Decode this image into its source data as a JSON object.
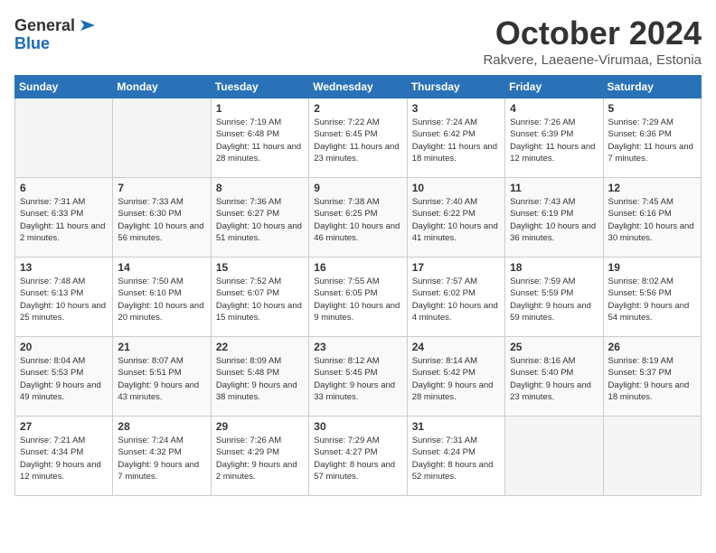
{
  "logo": {
    "general": "General",
    "blue": "Blue"
  },
  "title": "October 2024",
  "location": "Rakvere, Laeaene-Virumaa, Estonia",
  "headers": [
    "Sunday",
    "Monday",
    "Tuesday",
    "Wednesday",
    "Thursday",
    "Friday",
    "Saturday"
  ],
  "weeks": [
    [
      {
        "day": "",
        "content": ""
      },
      {
        "day": "",
        "content": ""
      },
      {
        "day": "1",
        "content": "Sunrise: 7:19 AM\nSunset: 6:48 PM\nDaylight: 11 hours and 28 minutes."
      },
      {
        "day": "2",
        "content": "Sunrise: 7:22 AM\nSunset: 6:45 PM\nDaylight: 11 hours and 23 minutes."
      },
      {
        "day": "3",
        "content": "Sunrise: 7:24 AM\nSunset: 6:42 PM\nDaylight: 11 hours and 18 minutes."
      },
      {
        "day": "4",
        "content": "Sunrise: 7:26 AM\nSunset: 6:39 PM\nDaylight: 11 hours and 12 minutes."
      },
      {
        "day": "5",
        "content": "Sunrise: 7:29 AM\nSunset: 6:36 PM\nDaylight: 11 hours and 7 minutes."
      }
    ],
    [
      {
        "day": "6",
        "content": "Sunrise: 7:31 AM\nSunset: 6:33 PM\nDaylight: 11 hours and 2 minutes."
      },
      {
        "day": "7",
        "content": "Sunrise: 7:33 AM\nSunset: 6:30 PM\nDaylight: 10 hours and 56 minutes."
      },
      {
        "day": "8",
        "content": "Sunrise: 7:36 AM\nSunset: 6:27 PM\nDaylight: 10 hours and 51 minutes."
      },
      {
        "day": "9",
        "content": "Sunrise: 7:38 AM\nSunset: 6:25 PM\nDaylight: 10 hours and 46 minutes."
      },
      {
        "day": "10",
        "content": "Sunrise: 7:40 AM\nSunset: 6:22 PM\nDaylight: 10 hours and 41 minutes."
      },
      {
        "day": "11",
        "content": "Sunrise: 7:43 AM\nSunset: 6:19 PM\nDaylight: 10 hours and 36 minutes."
      },
      {
        "day": "12",
        "content": "Sunrise: 7:45 AM\nSunset: 6:16 PM\nDaylight: 10 hours and 30 minutes."
      }
    ],
    [
      {
        "day": "13",
        "content": "Sunrise: 7:48 AM\nSunset: 6:13 PM\nDaylight: 10 hours and 25 minutes."
      },
      {
        "day": "14",
        "content": "Sunrise: 7:50 AM\nSunset: 6:10 PM\nDaylight: 10 hours and 20 minutes."
      },
      {
        "day": "15",
        "content": "Sunrise: 7:52 AM\nSunset: 6:07 PM\nDaylight: 10 hours and 15 minutes."
      },
      {
        "day": "16",
        "content": "Sunrise: 7:55 AM\nSunset: 6:05 PM\nDaylight: 10 hours and 9 minutes."
      },
      {
        "day": "17",
        "content": "Sunrise: 7:57 AM\nSunset: 6:02 PM\nDaylight: 10 hours and 4 minutes."
      },
      {
        "day": "18",
        "content": "Sunrise: 7:59 AM\nSunset: 5:59 PM\nDaylight: 9 hours and 59 minutes."
      },
      {
        "day": "19",
        "content": "Sunrise: 8:02 AM\nSunset: 5:56 PM\nDaylight: 9 hours and 54 minutes."
      }
    ],
    [
      {
        "day": "20",
        "content": "Sunrise: 8:04 AM\nSunset: 5:53 PM\nDaylight: 9 hours and 49 minutes."
      },
      {
        "day": "21",
        "content": "Sunrise: 8:07 AM\nSunset: 5:51 PM\nDaylight: 9 hours and 43 minutes."
      },
      {
        "day": "22",
        "content": "Sunrise: 8:09 AM\nSunset: 5:48 PM\nDaylight: 9 hours and 38 minutes."
      },
      {
        "day": "23",
        "content": "Sunrise: 8:12 AM\nSunset: 5:45 PM\nDaylight: 9 hours and 33 minutes."
      },
      {
        "day": "24",
        "content": "Sunrise: 8:14 AM\nSunset: 5:42 PM\nDaylight: 9 hours and 28 minutes."
      },
      {
        "day": "25",
        "content": "Sunrise: 8:16 AM\nSunset: 5:40 PM\nDaylight: 9 hours and 23 minutes."
      },
      {
        "day": "26",
        "content": "Sunrise: 8:19 AM\nSunset: 5:37 PM\nDaylight: 9 hours and 18 minutes."
      }
    ],
    [
      {
        "day": "27",
        "content": "Sunrise: 7:21 AM\nSunset: 4:34 PM\nDaylight: 9 hours and 12 minutes."
      },
      {
        "day": "28",
        "content": "Sunrise: 7:24 AM\nSunset: 4:32 PM\nDaylight: 9 hours and 7 minutes."
      },
      {
        "day": "29",
        "content": "Sunrise: 7:26 AM\nSunset: 4:29 PM\nDaylight: 9 hours and 2 minutes."
      },
      {
        "day": "30",
        "content": "Sunrise: 7:29 AM\nSunset: 4:27 PM\nDaylight: 8 hours and 57 minutes."
      },
      {
        "day": "31",
        "content": "Sunrise: 7:31 AM\nSunset: 4:24 PM\nDaylight: 8 hours and 52 minutes."
      },
      {
        "day": "",
        "content": ""
      },
      {
        "day": "",
        "content": ""
      }
    ]
  ]
}
